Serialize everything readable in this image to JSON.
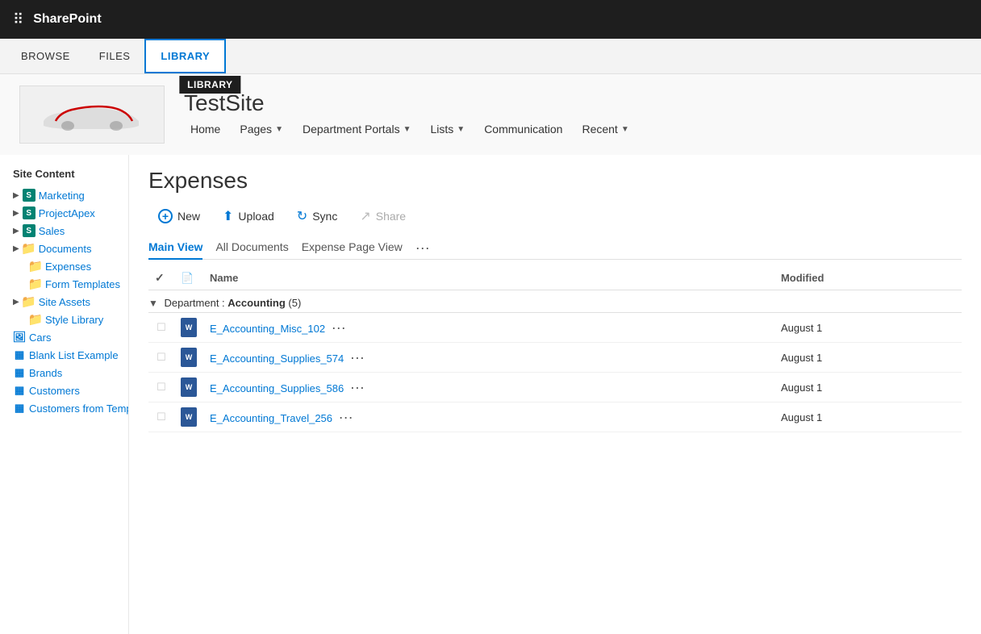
{
  "topbar": {
    "waffle": "⠿",
    "title": "SharePoint"
  },
  "tabbar": {
    "tabs": [
      {
        "id": "browse",
        "label": "BROWSE"
      },
      {
        "id": "files",
        "label": "FILES"
      },
      {
        "id": "library",
        "label": "LIBRARY",
        "active": true,
        "tooltip": "Library"
      }
    ]
  },
  "siteheader": {
    "sitename": "TestSite",
    "nav": [
      {
        "label": "Home",
        "hasDropdown": false
      },
      {
        "label": "Pages",
        "hasDropdown": true
      },
      {
        "label": "Department Portals",
        "hasDropdown": true
      },
      {
        "label": "Lists",
        "hasDropdown": true
      },
      {
        "label": "Communication",
        "hasDropdown": false
      },
      {
        "label": "Recent",
        "hasDropdown": true
      }
    ]
  },
  "sidebar": {
    "section_title": "Site Content",
    "items": [
      {
        "id": "marketing",
        "label": "Marketing",
        "iconType": "s-green",
        "hasChevron": true
      },
      {
        "id": "projectapex",
        "label": "ProjectApex",
        "iconType": "s-green",
        "hasChevron": true
      },
      {
        "id": "sales",
        "label": "Sales",
        "iconType": "s-green",
        "hasChevron": true
      },
      {
        "id": "documents",
        "label": "Documents",
        "iconType": "folder",
        "hasChevron": true
      },
      {
        "id": "expenses",
        "label": "Expenses",
        "iconType": "folder-sub",
        "hasChevron": false
      },
      {
        "id": "formtemplates",
        "label": "Form Templates",
        "iconType": "folder-sub",
        "hasChevron": false
      },
      {
        "id": "siteassets",
        "label": "Site Assets",
        "iconType": "folder",
        "hasChevron": true
      },
      {
        "id": "stylelibrary",
        "label": "Style Library",
        "iconType": "folder-sub",
        "hasChevron": false
      },
      {
        "id": "cars",
        "label": "Cars",
        "iconType": "img",
        "hasChevron": false
      },
      {
        "id": "blanklistexample",
        "label": "Blank List Example",
        "iconType": "list",
        "hasChevron": false
      },
      {
        "id": "brands",
        "label": "Brands",
        "iconType": "list",
        "hasChevron": false
      },
      {
        "id": "customers",
        "label": "Customers",
        "iconType": "list",
        "hasChevron": false
      },
      {
        "id": "customersfromtemplate",
        "label": "Customers from Template",
        "iconType": "list",
        "hasChevron": false
      }
    ]
  },
  "docspane": {
    "title": "Expenses",
    "toolbar": {
      "new_label": "New",
      "upload_label": "Upload",
      "sync_label": "Sync",
      "share_label": "Share"
    },
    "viewtabs": [
      {
        "id": "mainview",
        "label": "Main View",
        "active": true
      },
      {
        "id": "alldocuments",
        "label": "All Documents",
        "active": false
      },
      {
        "id": "expensepageview",
        "label": "Expense Page View",
        "active": false
      }
    ],
    "table": {
      "col_name": "Name",
      "col_modified": "Modified",
      "groups": [
        {
          "dept": "Department",
          "dept_value": "Accounting",
          "count": "(5)",
          "rows": [
            {
              "name": "E_Accounting_Misc_102",
              "modified": "August 1"
            },
            {
              "name": "E_Accounting_Supplies_574",
              "modified": "August 1"
            },
            {
              "name": "E_Accounting_Supplies_586",
              "modified": "August 1"
            },
            {
              "name": "E_Accounting_Travel_256",
              "modified": "August 1"
            }
          ]
        }
      ]
    }
  }
}
